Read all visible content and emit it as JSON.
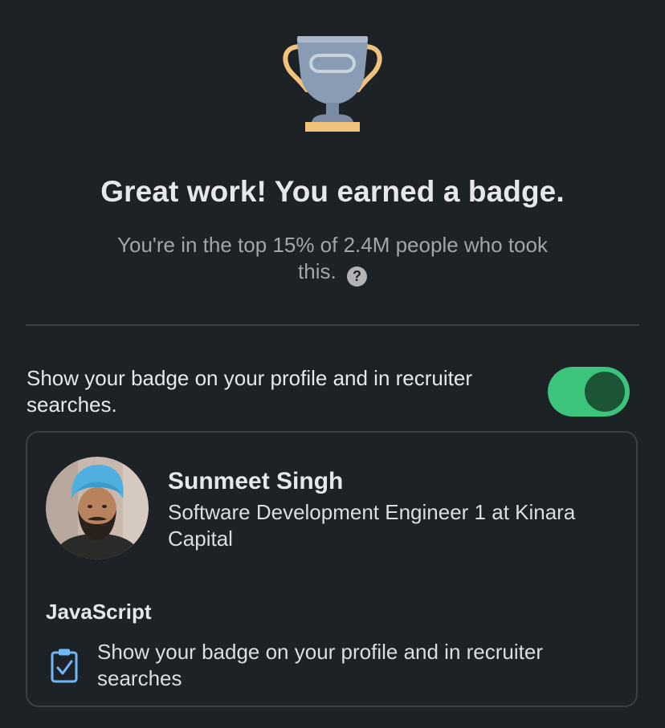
{
  "badge": {
    "icon": "trophy-icon",
    "headline": "Great work! You earned a badge.",
    "subtext": "You're in the top 15% of 2.4M people who took this.",
    "help_icon": "?"
  },
  "visibility": {
    "label": "Show your badge on your profile and in recruiter searches.",
    "enabled": true
  },
  "profile_card": {
    "name": "Sunmeet Singh",
    "headline": "Software Development Engineer 1 at Kinara Capital",
    "skill": "JavaScript",
    "skill_icon": "clipboard-check-icon",
    "skill_description": "Show your badge on your profile and in recruiter searches"
  },
  "colors": {
    "background": "#1d2226",
    "toggle_on": "#3cc37c",
    "toggle_knob": "#1c5436",
    "trophy_cup": "#8a9cb3",
    "trophy_handle": "#f0c27b",
    "clipboard": "#71b7fb"
  }
}
